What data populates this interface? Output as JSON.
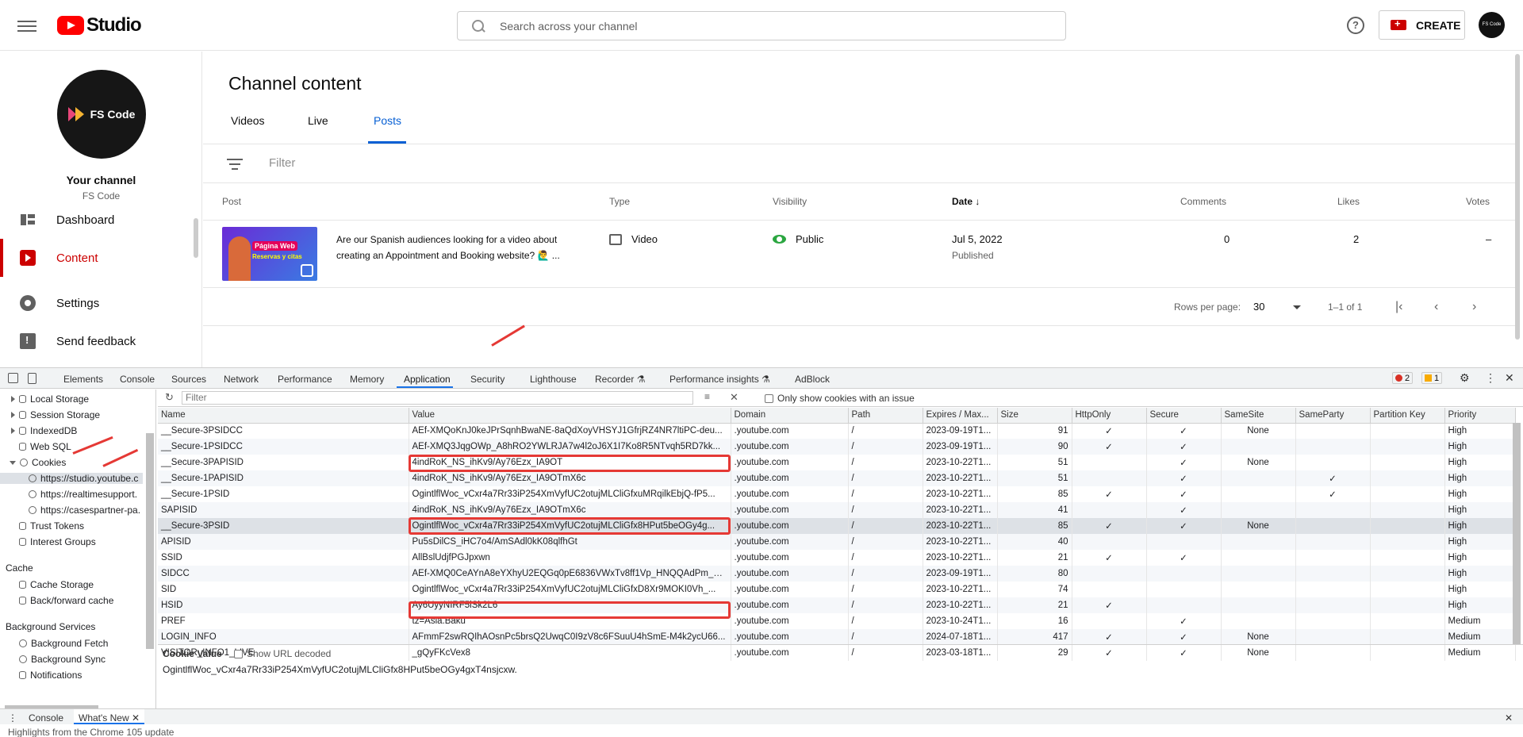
{
  "header": {
    "brand": "Studio",
    "search_placeholder": "Search across your channel",
    "help": "?",
    "create_label": "CREATE",
    "avatar_text": "FS Code"
  },
  "sidebar": {
    "avatar_text": "FS Code",
    "your_channel": "Your channel",
    "channel_name": "FS Code",
    "items": [
      {
        "label": "Dashboard",
        "icon": "dashboard-icon"
      },
      {
        "label": "Content",
        "icon": "content-icon"
      },
      {
        "label": "Settings",
        "icon": "gear-icon"
      },
      {
        "label": "Send feedback",
        "icon": "feedback-icon"
      }
    ]
  },
  "main": {
    "title": "Channel content",
    "tabs": [
      "Videos",
      "Live",
      "Posts"
    ],
    "filter_placeholder": "Filter",
    "columns": [
      "Post",
      "Type",
      "Visibility",
      "Date",
      "Comments",
      "Likes",
      "Votes"
    ],
    "post": {
      "thumb_line1": "Página Web",
      "thumb_line2": "Reservas y citas",
      "text": "Are our Spanish audiences looking for a video about creating an Appointment and Booking website? 🙋‍♂️ ...",
      "type": "Video",
      "visibility": "Public",
      "date": "Jul 5, 2022",
      "date_sub": "Published",
      "comments": "0",
      "likes": "2",
      "votes": "–"
    },
    "pagination": {
      "rows_per_page_label": "Rows per page:",
      "rows_per_page": "30",
      "range": "1–1 of 1"
    }
  },
  "devtools": {
    "tabs": [
      "Elements",
      "Console",
      "Sources",
      "Network",
      "Performance",
      "Memory",
      "Application",
      "Security",
      "Lighthouse",
      "Recorder ⚗",
      "Performance insights ⚗",
      "AdBlock"
    ],
    "errors": "2",
    "warnings": "1",
    "sidebar": {
      "storage": [
        "Local Storage",
        "Session Storage",
        "IndexedDB",
        "Web SQL",
        "Cookies"
      ],
      "cookie_origins": [
        "https://studio.youtube.c",
        "https://realtimesupport.",
        "https://casespartner-pa."
      ],
      "other": [
        "Trust Tokens",
        "Interest Groups"
      ],
      "cache_header": "Cache",
      "cache": [
        "Cache Storage",
        "Back/forward cache"
      ],
      "bg_header": "Background Services",
      "bg": [
        "Background Fetch",
        "Background Sync",
        "Notifications"
      ]
    },
    "filter_placeholder": "Filter",
    "only_issue_label": "Only show cookies with an issue",
    "columns": [
      "Name",
      "Value",
      "Domain",
      "Path",
      "Expires / Max...",
      "Size",
      "HttpOnly",
      "Secure",
      "SameSite",
      "SameParty",
      "Partition Key",
      "Priority"
    ],
    "cookies": [
      [
        "__Secure-3PSIDCC",
        "AEf-XMQoKnJ0keJPrSqnhBwaNE-8aQdXoyVHSYJ1GfrjRZ4NR7ltiPC-deu...",
        ".youtube.com",
        "/",
        "2023-09-19T1...",
        "91",
        "✓",
        "✓",
        "None",
        "",
        "",
        "High"
      ],
      [
        "__Secure-1PSIDCC",
        "AEf-XMQ3JqgOWp_A8hRO2YWLRJA7w4l2oJ6X1I7Ko8R5NTvqh5RD7kk...",
        ".youtube.com",
        "/",
        "2023-09-19T1...",
        "90",
        "✓",
        "✓",
        "",
        "",
        "",
        "High"
      ],
      [
        "__Secure-3PAPISID",
        "4indRoK_NS_ihKv9/Ay76Ezx_IA9OT",
        ".youtube.com",
        "/",
        "2023-10-22T1...",
        "51",
        "",
        "✓",
        "None",
        "",
        "",
        "High"
      ],
      [
        "__Secure-1PAPISID",
        "4indRoK_NS_ihKv9/Ay76Ezx_IA9OTmX6c",
        ".youtube.com",
        "/",
        "2023-10-22T1...",
        "51",
        "",
        "✓",
        "",
        "✓",
        "",
        "High"
      ],
      [
        "__Secure-1PSID",
        "OgintlflWoc_vCxr4a7Rr33iP254XmVyfUC2otujMLCliGfxuMRqilkEbjQ-fP5...",
        ".youtube.com",
        "/",
        "2023-10-22T1...",
        "85",
        "✓",
        "✓",
        "",
        "✓",
        "",
        "High"
      ],
      [
        "SAPISID",
        "4indRoK_NS_ihKv9/Ay76Ezx_IA9OTmX6c",
        ".youtube.com",
        "/",
        "2023-10-22T1...",
        "41",
        "",
        "✓",
        "",
        "",
        "",
        "High"
      ],
      [
        "__Secure-3PSID",
        "OgintlflWoc_vCxr4a7Rr33iP254XmVyfUC2otujMLCliGfx8HPut5beOGy4g...",
        ".youtube.com",
        "/",
        "2023-10-22T1...",
        "85",
        "✓",
        "✓",
        "None",
        "",
        "",
        "High"
      ],
      [
        "APISID",
        "Pu5sDilCS_iHC7o4/AmSAdl0kK08qlfhGt",
        ".youtube.com",
        "/",
        "2023-10-22T1...",
        "40",
        "",
        "",
        "",
        "",
        "",
        "High"
      ],
      [
        "SSID",
        "AllBslUdjfPGJpxwn",
        ".youtube.com",
        "/",
        "2023-10-22T1...",
        "21",
        "✓",
        "✓",
        "",
        "",
        "",
        "High"
      ],
      [
        "SIDCC",
        "AEf-XMQ0CeAYnA8eYXhyU2EQGq0pE6836VWxTv8ff1Vp_HNQQAdPm_B...",
        ".youtube.com",
        "/",
        "2023-09-19T1...",
        "80",
        "",
        "",
        "",
        "",
        "",
        "High"
      ],
      [
        "SID",
        "OgintlflWoc_vCxr4a7Rr33iP254XmVyfUC2otujMLCliGfxD8Xr9MOKI0Vh_...",
        ".youtube.com",
        "/",
        "2023-10-22T1...",
        "74",
        "",
        "",
        "",
        "",
        "",
        "High"
      ],
      [
        "HSID",
        "Ay6UyyNIRF5iSk2L6",
        ".youtube.com",
        "/",
        "2023-10-22T1...",
        "21",
        "✓",
        "",
        "",
        "",
        "",
        "High"
      ],
      [
        "PREF",
        "tz=Asia.Baku",
        ".youtube.com",
        "/",
        "2023-10-24T1...",
        "16",
        "",
        "✓",
        "",
        "",
        "",
        "Medium"
      ],
      [
        "LOGIN_INFO",
        "AFmmF2swRQIhAOsnPc5brsQ2UwqC0I9zV8c6FSuuU4hSmE-M4k2ycU66...",
        ".youtube.com",
        "/",
        "2024-07-18T1...",
        "417",
        "✓",
        "✓",
        "None",
        "",
        "",
        "Medium"
      ],
      [
        "VISITOR_INFO1_LIVE",
        "_gQyFKcVex8",
        ".youtube.com",
        "/",
        "2023-03-18T1...",
        "29",
        "✓",
        "✓",
        "None",
        "",
        "",
        "Medium"
      ]
    ],
    "cookie_value_label": "Cookie Value",
    "show_url_decoded": "Show URL decoded",
    "cookie_value": "OgintlflWoc_vCxr4a7Rr33iP254XmVyfUC2otujMLCliGfx8HPut5beOGy4gxT4nsjcxw.",
    "drawer_tabs": [
      "Console",
      "What's New"
    ],
    "drawer_line": "Highlights from the Chrome 105 update"
  },
  "colors": {
    "accent": "#065fd4",
    "brand_red": "#ff0000",
    "annotation_red": "#e53935"
  }
}
